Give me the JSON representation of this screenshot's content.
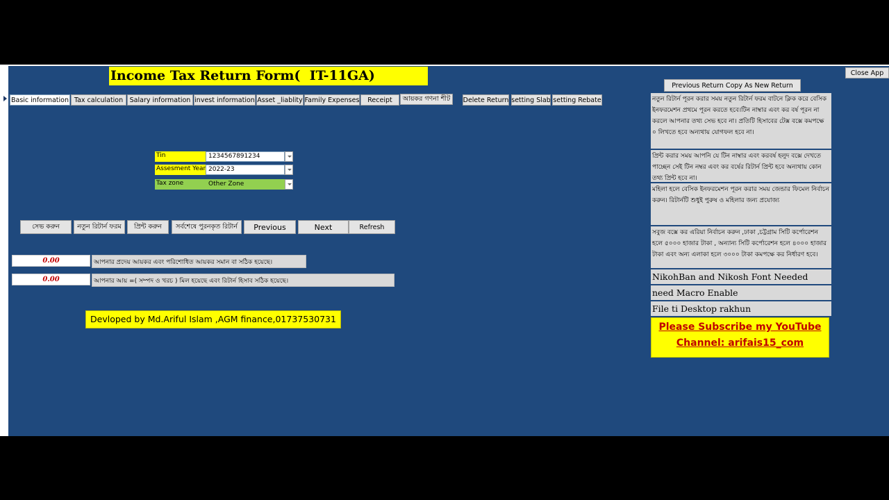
{
  "header": {
    "title": "Income Tax Return Form(  IT-11GA)",
    "copy_button": "Previous Return Copy As New Return",
    "close_button": "Close App"
  },
  "tabs": [
    "Basic information",
    "Tax calculation",
    "Salary information",
    "invest information",
    "Asset _liablity",
    "Family Expenses",
    "Receipt",
    "আয়কর গণনা শীট",
    "Delete Return",
    "setting Slab",
    "setting Rebate"
  ],
  "form": {
    "tin_label": "Tin",
    "tin_value": "1234567891234",
    "year_label": "Assesment Year",
    "year_value": "2022-23",
    "zone_label": "Tax zone",
    "zone_value": "Other Zone"
  },
  "actions": {
    "save": "সেভ করুন",
    "new_return": "নতুন রিটার্ন ফরম",
    "print": "প্রিন্ট করুন",
    "last_return": "সর্বশেষে পুরনকৃত রিটার্ন",
    "previous": "Previous",
    "next": "Next",
    "refresh": "Refresh"
  },
  "checks": [
    {
      "value": "0.00",
      "message": "আপনার  প্রদেয় আয়কর এবং পরিশোধিত আয়কর সমান বা সঠিক হয়েছে।"
    },
    {
      "value": "0.00",
      "message": "আপনার  আয় =( সম্পদ  ও খরচ ) মিল হয়েছে এবং রিটার্ন হিসাব সঠিক হয়েছে।"
    }
  ],
  "credit": "Devloped by Md.Ariful Islam ,AGM finance,01737530731",
  "notes": {
    "n1": "নতুন রিটার্ন পূরন করার সময় নতুন রিটার্ন ফরম বাটনে ক্লিক করে বেসিক ইনফরমেশন প্রথমে পূরন করতে হবে।টিন নাম্বার এবং কর বর্ষ পূরন না করলে আপনার তথ্য সেভ হবে না। প্রতিটি হিসাবের টেক্স বক্সে কমপক্ষে ০ লিখতে হবে অন্যথায় যোগফল হবে না।",
    "n2": "প্রিন্ট করার সময় আপনি যে টিন নাম্বার এবং করবর্ষ হলুদ বক্সে দেখতে পাচ্ছেন সেই টিন নম্বর এবং কর বর্ষের রিটার্ন প্রিন্ট হবে অন্যথায় কোন তথ্য প্রিন্ট হবে না।",
    "n3": "মহিলা হলে  বেসিক ইনফরমেশন পূরন করার সময়  জেন্ডার ফিমেল নির্বাচন করুন। রিটার্নটি শুধুই পুরুষ ও মহিলার জন্য প্রযোজ্য",
    "n4": "সবুজ বক্সে কর এরিয়া নির্বাচন করুন ,ঢাকা ,চট্টগ্রাম সিটি কর্পোরেশন হলে ৫০০০ হাজার টাকা , অন্যান্য সিটি কর্পোরেশন হলে ৪০০০ হাজার টাকা এবং অন্য এলাকা হলে ৩০০০ টাকা কমপক্ষে কর নির্ধারণ হবে।",
    "font": "NikohBan and Nikosh Font Needed",
    "macro": "need Macro Enable",
    "desktop": "File ti Desktop rakhun"
  },
  "subscribe": {
    "line1": "Please Subscribe my YouTube",
    "line2": "Channel: arifais15_com"
  },
  "colors": {
    "background": "#1f497d",
    "highlight": "#ffff00",
    "zone": "#92d050",
    "error_text": "#c00000"
  }
}
